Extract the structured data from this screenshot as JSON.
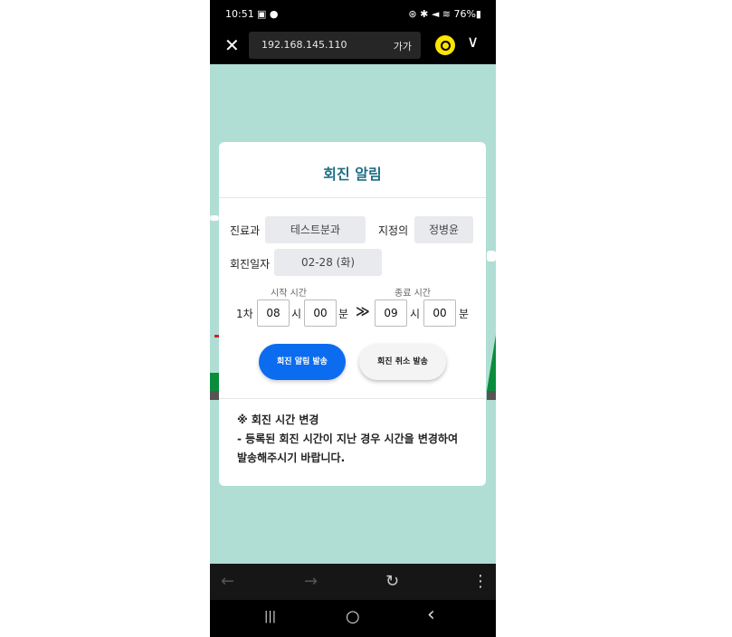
{
  "status": {
    "time": "10:51",
    "left_icons": "▣ ●",
    "right": "⊛ ✱ ◄ ≋ 76%▮"
  },
  "browser": {
    "url": "192.168.145.110",
    "font_size_label": "가가",
    "close_glyph": "✕",
    "chevron_glyph": "∨"
  },
  "modal": {
    "title": "회진 알림",
    "dept_label": "진료과",
    "dept_value": "테스트분과",
    "doctor_label": "지정의",
    "doctor_value": "정병윤",
    "date_label": "회진일자",
    "date_value": "02-28 (화)",
    "start_caption": "시작 시간",
    "end_caption": "종료 시간",
    "round_label": "1차",
    "start_hour": "08",
    "hour_unit": "시",
    "start_min": "00",
    "min_unit": "분",
    "arrow": "≫",
    "end_hour": "09",
    "end_min": "00",
    "send_button": "회진 알림 발송",
    "cancel_button": "회진 취소 발송",
    "notice_title": "※ 회진 시간 변경",
    "notice_line1": "- 등록된 회진 시간이 지난 경우 시간을 변경하여",
    "notice_line2": "발송해주시기 바랍니다."
  },
  "nav": {
    "back": "←",
    "forward": "→",
    "reload": "↻",
    "menu": "⋮"
  },
  "system_nav": {
    "recents": "|||",
    "home": "○",
    "back": "‹"
  },
  "colors": {
    "accent": "#0b6cf0",
    "title": "#1f6f86",
    "background": "#b0ded4"
  }
}
